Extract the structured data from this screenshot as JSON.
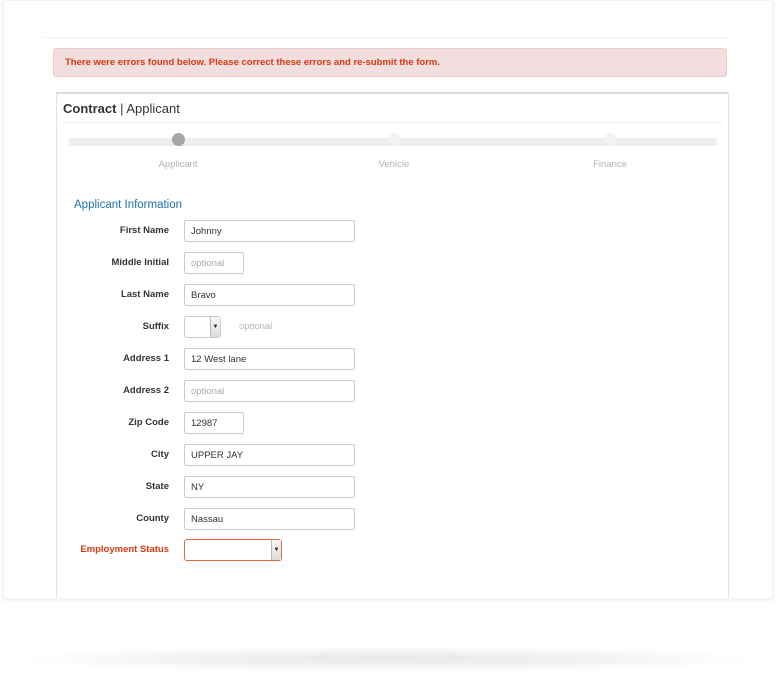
{
  "alert": {
    "message": "There were errors found below. Please correct these errors and re-submit the form.",
    "color": "#d9380e"
  },
  "panel": {
    "title_bold": "Contract",
    "title_separator": " | ",
    "title_rest": "Applicant"
  },
  "steps": [
    {
      "label": "Applicant",
      "active": true
    },
    {
      "label": "Vehicle",
      "active": false
    },
    {
      "label": "Finance",
      "active": false
    }
  ],
  "section": {
    "title": "Applicant Information"
  },
  "fields": {
    "first_name": {
      "label": "First Name",
      "value": "Johnny",
      "placeholder": ""
    },
    "middle_initial": {
      "label": "Middle Initial",
      "value": "",
      "placeholder": "optional"
    },
    "last_name": {
      "label": "Last Name",
      "value": "Bravo",
      "placeholder": ""
    },
    "suffix": {
      "label": "Suffix",
      "value": "",
      "hint": "optional"
    },
    "address1": {
      "label": "Address 1",
      "value": "12 West lane",
      "placeholder": ""
    },
    "address2": {
      "label": "Address 2",
      "value": "",
      "placeholder": "optional"
    },
    "zip": {
      "label": "Zip Code",
      "value": "12987",
      "placeholder": ""
    },
    "city": {
      "label": "City",
      "value": "UPPER JAY",
      "placeholder": ""
    },
    "state": {
      "label": "State",
      "value": "NY",
      "placeholder": ""
    },
    "county": {
      "label": "County",
      "value": "Nassau",
      "placeholder": ""
    },
    "employment_status": {
      "label": "Employment Status",
      "value": "",
      "error": true
    }
  },
  "icons": {
    "dropdown": "▼"
  },
  "colors": {
    "error": "#d9380e",
    "section_title": "#1d6fb0",
    "alert_bg": "#f2dede"
  }
}
